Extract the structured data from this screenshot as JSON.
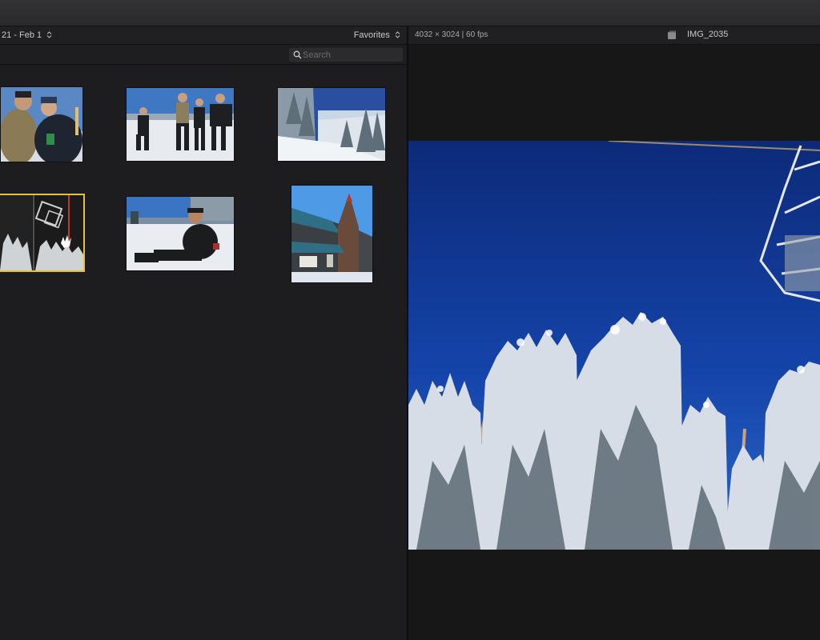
{
  "browser": {
    "date_range": "21 - Feb 1",
    "filter": "Favorites",
    "search": {
      "placeholder": "Search",
      "value": ""
    },
    "clips": [
      {
        "name": "group-selfie-thumbnail"
      },
      {
        "name": "group-on-snow-thumbnail"
      },
      {
        "name": "snowy-forest-thumbnail"
      },
      {
        "name": "ski-lift-trees-thumbnail",
        "selected": true
      },
      {
        "name": "sitting-in-snow-thumbnail"
      },
      {
        "name": "lodge-building-thumbnail"
      }
    ]
  },
  "viewer": {
    "clip_info": "4032 × 3024 | 60 fps",
    "clip_name": "IMG_2035"
  },
  "colors": {
    "selection": "#e3c13b",
    "background": "#1a1a1b"
  }
}
